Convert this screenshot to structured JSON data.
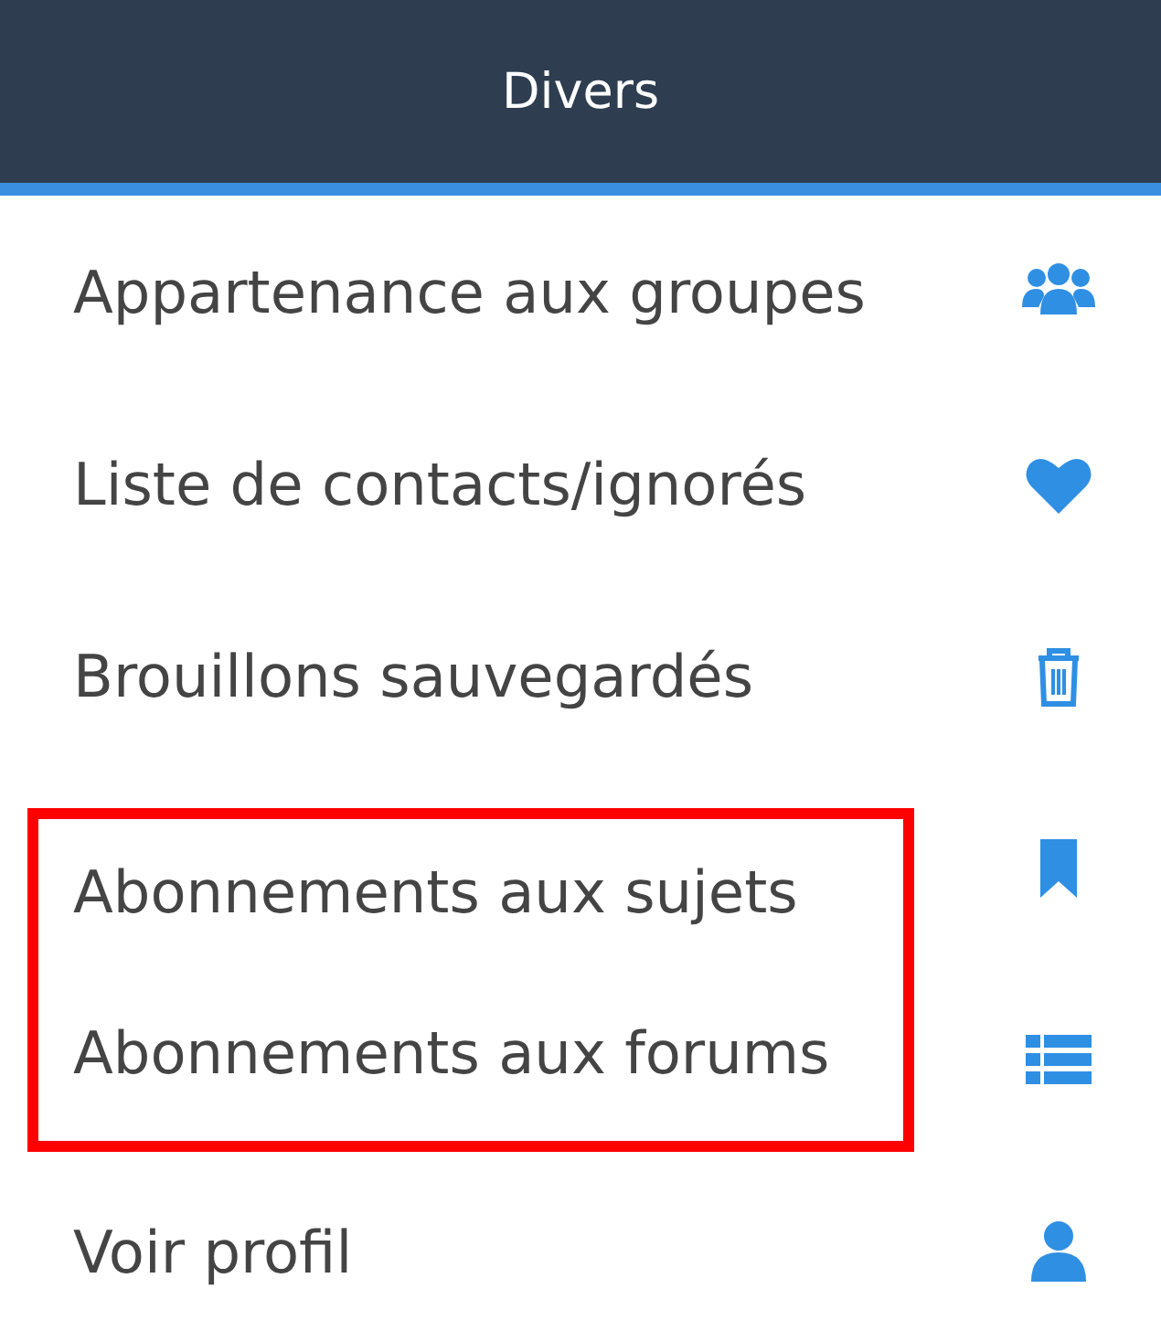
{
  "header": {
    "title": "Divers"
  },
  "items": [
    {
      "label": "Appartenance aux groupes",
      "highlighted": false
    },
    {
      "label": "Liste de contacts/ignorés",
      "highlighted": false
    },
    {
      "label": "Brouillons sauvegardés",
      "highlighted": false
    },
    {
      "label": "Abonnements aux sujets",
      "highlighted": true
    },
    {
      "label": "Abonnements aux forums",
      "highlighted": true
    },
    {
      "label": "Voir profil",
      "highlighted": false
    }
  ]
}
